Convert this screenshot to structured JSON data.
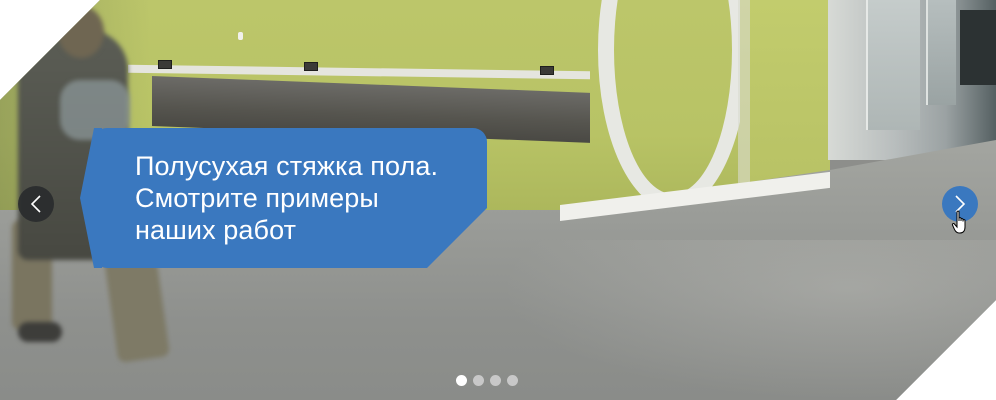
{
  "slider": {
    "caption": {
      "lines": [
        "Полусухая стяжка пола.",
        "Смотрите примеры",
        "наших работ"
      ]
    },
    "prev_icon": "chevron-left-icon",
    "next_icon": "chevron-right-icon",
    "cursor_icon": "hand-pointer-icon",
    "pagination": {
      "total": 4,
      "active_index": 0
    },
    "colors": {
      "accent": "#3a78bf",
      "prev_button": "#2a2c2e",
      "dot_active": "#ffffff",
      "dot_inactive": "#dcdcdc"
    }
  }
}
